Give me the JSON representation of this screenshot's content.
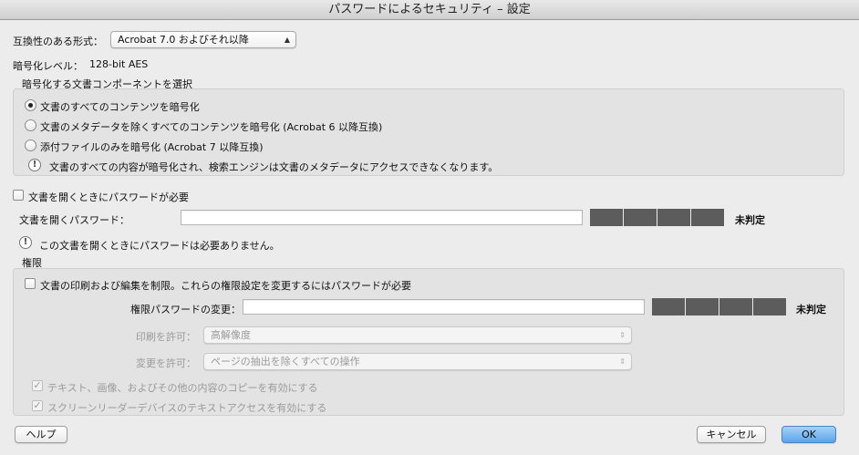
{
  "window": {
    "title": "パスワードによるセキュリティ – 設定"
  },
  "compat": {
    "label": "互換性のある形式：",
    "selected": "Acrobat 7.0 およびそれ以降"
  },
  "encryption_level": {
    "label": "暗号化レベル：",
    "value": "128-bit AES"
  },
  "components": {
    "group_label": "暗号化する文書コンポーネントを選択",
    "options": [
      {
        "label": "文書のすべてのコンテンツを暗号化",
        "selected": true
      },
      {
        "label": "文書のメタデータを除くすべてのコンテンツを暗号化 (Acrobat 6 以降互換)",
        "selected": false
      },
      {
        "label": "添付ファイルのみを暗号化 (Acrobat 7 以降互換)",
        "selected": false
      }
    ],
    "note": "文書のすべての内容が暗号化され、検索エンジンは文書のメタデータにアクセスできなくなります。"
  },
  "open_password": {
    "require_label": "文書を開くときにパスワードが必要",
    "field_label": "文書を開くパスワード：",
    "value": "",
    "strength": "未判定",
    "note": "この文書を開くときにパスワードは必要ありません。"
  },
  "permissions": {
    "group_label": "権限",
    "restrict_label": "文書の印刷および編集を制限。これらの権限設定を変更するにはパスワードが必要",
    "change_password_label": "権限パスワードの変更：",
    "value": "",
    "strength": "未判定",
    "print_label": "印刷を許可：",
    "print_value": "高解像度",
    "change_label": "変更を許可：",
    "change_value": "ページの抽出を除くすべての操作",
    "copy_label": "テキスト、画像、およびその他の内容のコピーを有効にする",
    "screenreader_label": "スクリーンリーダーデバイスのテキストアクセスを有効にする"
  },
  "buttons": {
    "help": "ヘルプ",
    "cancel": "キャンセル",
    "ok": "OK"
  }
}
